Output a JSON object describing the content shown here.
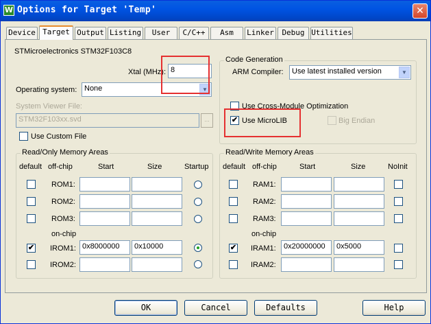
{
  "window": {
    "title": "Options for Target 'Temp'",
    "icon": "W",
    "close": "✕"
  },
  "tabs": [
    "Device",
    "Target",
    "Output",
    "Listing",
    "User",
    "C/C++",
    "Asm",
    "Linker",
    "Debug",
    "Utilities"
  ],
  "active_tab": "Target",
  "device": "STMicroelectronics STM32F103C8",
  "xtal": {
    "label": "Xtal (MHz):",
    "value": "8"
  },
  "os": {
    "label": "Operating system:",
    "value": "None"
  },
  "svf": {
    "label": "System Viewer File:",
    "value": "STM32F103xx.svd",
    "browse": "..."
  },
  "custom_file": {
    "label": "Use Custom File",
    "checked": false
  },
  "codegen": {
    "title": "Code Generation",
    "compiler_label": "ARM Compiler:",
    "compiler_value": "Use latest installed version",
    "cross_module": {
      "label": "Use Cross-Module Optimization",
      "checked": false
    },
    "microlib": {
      "label": "Use MicroLIB",
      "checked": true
    },
    "big_endian": {
      "label": "Big Endian",
      "checked": false
    }
  },
  "rom": {
    "title": "Read/Only Memory Areas",
    "headers": {
      "default": "default",
      "offchip": "off-chip",
      "start": "Start",
      "size": "Size",
      "startup": "Startup"
    },
    "onchip": "on-chip",
    "rows": [
      {
        "name": "ROM1:",
        "start": "",
        "size": "",
        "default": false,
        "startup": false
      },
      {
        "name": "ROM2:",
        "start": "",
        "size": "",
        "default": false,
        "startup": false
      },
      {
        "name": "ROM3:",
        "start": "",
        "size": "",
        "default": false,
        "startup": false
      },
      {
        "name": "IROM1:",
        "start": "0x8000000",
        "size": "0x10000",
        "default": true,
        "startup": true
      },
      {
        "name": "IROM2:",
        "start": "",
        "size": "",
        "default": false,
        "startup": false
      }
    ]
  },
  "ram": {
    "title": "Read/Write Memory Areas",
    "headers": {
      "default": "default",
      "offchip": "off-chip",
      "start": "Start",
      "size": "Size",
      "noinit": "NoInit"
    },
    "onchip": "on-chip",
    "rows": [
      {
        "name": "RAM1:",
        "start": "",
        "size": "",
        "default": false,
        "noinit": false
      },
      {
        "name": "RAM2:",
        "start": "",
        "size": "",
        "default": false,
        "noinit": false
      },
      {
        "name": "RAM3:",
        "start": "",
        "size": "",
        "default": false,
        "noinit": false
      },
      {
        "name": "IRAM1:",
        "start": "0x20000000",
        "size": "0x5000",
        "default": true,
        "noinit": false
      },
      {
        "name": "IRAM2:",
        "start": "",
        "size": "",
        "default": false,
        "noinit": false
      }
    ]
  },
  "buttons": {
    "ok": "OK",
    "cancel": "Cancel",
    "defaults": "Defaults",
    "help": "Help"
  },
  "colors": {
    "highlight": "#e53030",
    "titlebar": "#0054e3",
    "tab_accent": "#e68b2c"
  },
  "icons": {
    "check": "✔",
    "dropdown": "▼"
  }
}
